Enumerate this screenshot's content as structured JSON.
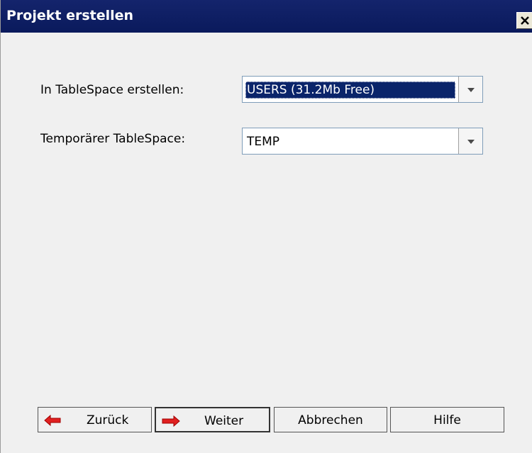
{
  "dialog": {
    "title": "Projekt erstellen",
    "close_label": "X"
  },
  "form": {
    "tablespace_label": "In TableSpace erstellen:",
    "tablespace_value": "USERS (31.2Mb Free)",
    "temp_tablespace_label": "Temporärer TableSpace:",
    "temp_tablespace_value": "TEMP"
  },
  "buttons": {
    "back_label": "Zurück",
    "next_label": "Weiter",
    "cancel_label": "Abbrechen",
    "help_label": "Hilfe"
  },
  "icons": {
    "back": "arrow-left-icon",
    "next": "arrow-right-icon",
    "dropdown": "chevron-down-icon",
    "close": "close-icon"
  },
  "colors": {
    "titlebar": "#0a1a5c",
    "selection": "#0a246a",
    "arrow_red": "#e02020"
  }
}
